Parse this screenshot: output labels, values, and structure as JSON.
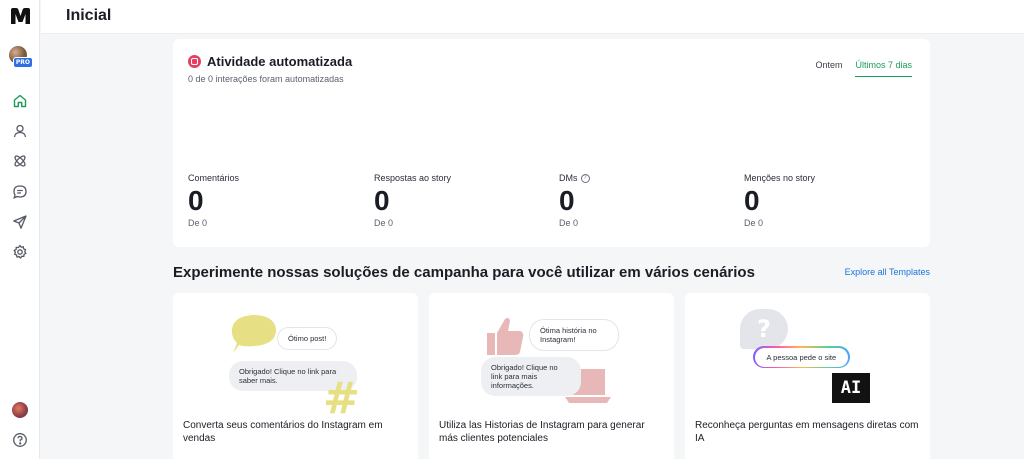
{
  "header": {
    "title": "Inicial"
  },
  "sidebar": {
    "logo_icon": "manychat-logo",
    "badge": "PRO",
    "nav": [
      {
        "name": "home-icon",
        "active": true
      },
      {
        "name": "contacts-icon"
      },
      {
        "name": "automation-icon"
      },
      {
        "name": "chat-icon"
      },
      {
        "name": "broadcast-icon"
      },
      {
        "name": "settings-icon"
      }
    ]
  },
  "activity": {
    "title": "Atividade automatizada",
    "subtitle": "0 de 0 interações foram automatizadas",
    "tabs": [
      {
        "label": "Ontem",
        "active": false
      },
      {
        "label": "Últimos 7 dias",
        "active": true
      }
    ],
    "stats": [
      {
        "label": "Comentários",
        "value": "0",
        "note": "De 0"
      },
      {
        "label": "Respostas ao story",
        "value": "0",
        "note": "De 0"
      },
      {
        "label": "DMs",
        "value": "0",
        "note": "De 0"
      },
      {
        "label": "Menções no story",
        "value": "0",
        "note": "De 0"
      }
    ]
  },
  "templates_section": {
    "title": "Experimente nossas soluções de campanha para você utilizar em vários cenários",
    "explore_link": "Explore all Templates",
    "cards": [
      {
        "caption": "Converta seus comentários do Instagram em vendas",
        "bubble_top": "Ótimo post!",
        "bubble_bottom": "Obrigado! Clique no link para saber mais.",
        "symbol": "#"
      },
      {
        "caption": "Utiliza las Historias de Instagram para generar más clientes potenciales",
        "bubble_top": "Ótima história no Instagram!",
        "bubble_bottom": "Obrigado! Clique no link para mais informações."
      },
      {
        "caption": "Reconheça perguntas em mensagens diretas com IA",
        "bubble_top": "A pessoa pede o site",
        "symbol": "?",
        "badge": "AI"
      }
    ]
  },
  "colors": {
    "accent": "#1a9c58",
    "link": "#1b74d8",
    "instagram": "#e4405f"
  }
}
